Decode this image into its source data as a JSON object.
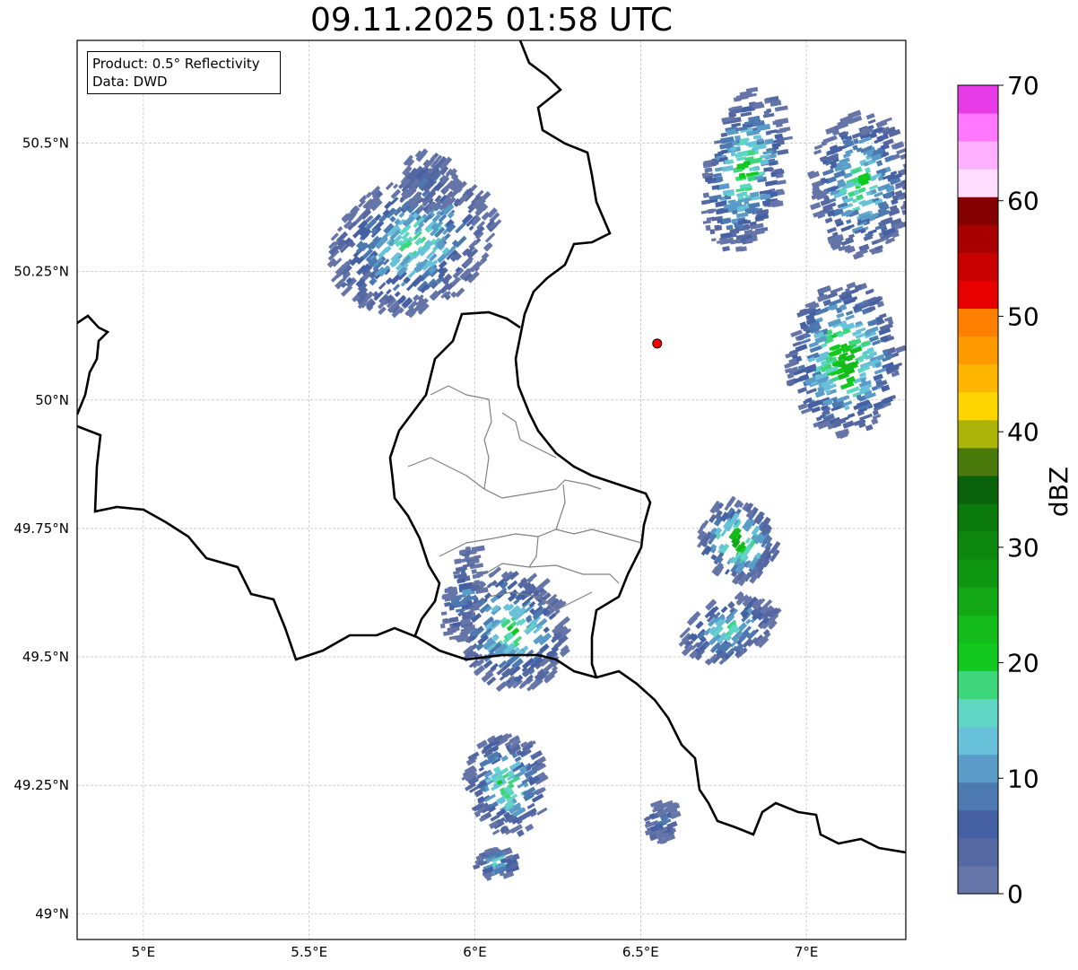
{
  "title": "09.11.2025 01:58 UTC",
  "info_box": {
    "product": "Product: 0.5° Reflectivity",
    "data": "Data: DWD"
  },
  "map": {
    "lon_range": [
      4.8,
      7.3
    ],
    "lat_range": [
      48.95,
      50.7
    ],
    "x_ticks": [
      {
        "value": 5.0,
        "label": "5°E"
      },
      {
        "value": 5.5,
        "label": "5.5°E"
      },
      {
        "value": 6.0,
        "label": "6°E"
      },
      {
        "value": 6.5,
        "label": "6.5°E"
      },
      {
        "value": 7.0,
        "label": "7°E"
      }
    ],
    "y_ticks": [
      {
        "value": 49.0,
        "label": "49°N"
      },
      {
        "value": 49.25,
        "label": "49.25°N"
      },
      {
        "value": 49.5,
        "label": "49.5°N"
      },
      {
        "value": 49.75,
        "label": "49.75°N"
      },
      {
        "value": 50.0,
        "label": "50°N"
      },
      {
        "value": 50.25,
        "label": "50.25°N"
      },
      {
        "value": 50.5,
        "label": "50.5°N"
      }
    ],
    "gridlines": true,
    "radar_site": {
      "lon": 6.55,
      "lat": 50.11,
      "color": "#ff0000"
    },
    "echoes": [
      {
        "lon": 5.8,
        "lat": 50.3,
        "rlon": 0.26,
        "rlat": 0.13,
        "rot": -25,
        "max_dbz": 22
      },
      {
        "lon": 5.85,
        "lat": 50.42,
        "rlon": 0.08,
        "rlat": 0.06,
        "rot": -30,
        "max_dbz": 12
      },
      {
        "lon": 6.1,
        "lat": 49.55,
        "rlon": 0.16,
        "rlat": 0.12,
        "rot": -20,
        "max_dbz": 24
      },
      {
        "lon": 6.08,
        "lat": 49.25,
        "rlon": 0.12,
        "rlat": 0.1,
        "rot": -10,
        "max_dbz": 24
      },
      {
        "lon": 6.05,
        "lat": 49.1,
        "rlon": 0.06,
        "rlat": 0.03,
        "rot": 0,
        "max_dbz": 22
      },
      {
        "lon": 6.78,
        "lat": 49.72,
        "rlon": 0.11,
        "rlat": 0.08,
        "rot": -35,
        "max_dbz": 30
      },
      {
        "lon": 6.75,
        "lat": 49.55,
        "rlon": 0.15,
        "rlat": 0.06,
        "rot": -25,
        "max_dbz": 22
      },
      {
        "lon": 6.8,
        "lat": 50.45,
        "rlon": 0.12,
        "rlat": 0.16,
        "rot": 10,
        "max_dbz": 26
      },
      {
        "lon": 7.1,
        "lat": 50.08,
        "rlon": 0.17,
        "rlat": 0.15,
        "rot": 0,
        "max_dbz": 30
      },
      {
        "lon": 7.15,
        "lat": 50.42,
        "rlon": 0.15,
        "rlat": 0.14,
        "rot": 0,
        "max_dbz": 24
      },
      {
        "lon": 6.55,
        "lat": 49.18,
        "rlon": 0.05,
        "rlat": 0.04,
        "rot": 0,
        "max_dbz": 12
      },
      {
        "lon": 5.95,
        "lat": 49.62,
        "rlon": 0.05,
        "rlat": 0.1,
        "rot": 10,
        "max_dbz": 14
      }
    ]
  },
  "colorbar": {
    "label": "dBZ",
    "min": 0,
    "max": 70,
    "step": 2.5,
    "ticks": [
      0,
      10,
      20,
      30,
      40,
      50,
      60,
      70
    ],
    "colors": [
      "#6575a8",
      "#5568a2",
      "#4560a3",
      "#4c7ab0",
      "#5a9cc7",
      "#66c1d9",
      "#5fd6c4",
      "#3dd67a",
      "#13c91f",
      "#13bb1b",
      "#12a816",
      "#109712",
      "#0d870e",
      "#0b7a0c",
      "#0a620c",
      "#4a7a0c",
      "#acb40a",
      "#ffd500",
      "#ffb600",
      "#ff9900",
      "#ff7f00",
      "#e60000",
      "#c90000",
      "#a80000",
      "#830000",
      "#ffddff",
      "#ffb0ff",
      "#ff78ff",
      "#e83be8"
    ]
  }
}
